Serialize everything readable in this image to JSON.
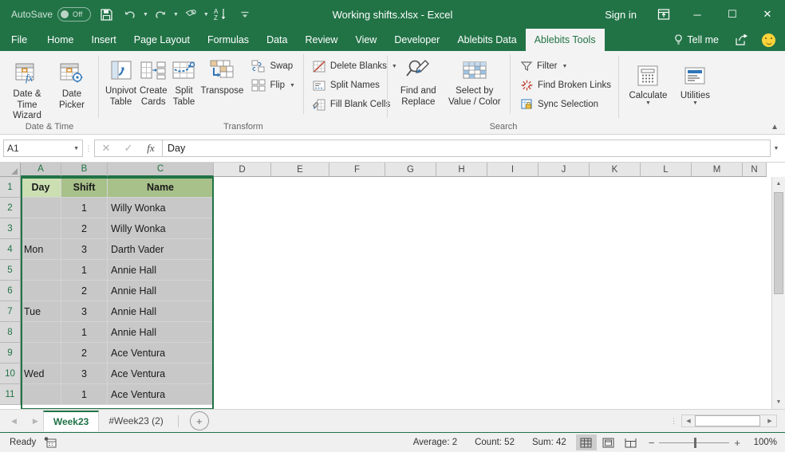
{
  "titlebar": {
    "autosave_label": "AutoSave",
    "autosave_state": "Off",
    "document_title": "Working shifts.xlsx  -  Excel",
    "signin_label": "Sign in",
    "minimize_label": "─",
    "maximize_label": "☐",
    "close_label": "✕",
    "qat": [
      {
        "name": "save-icon",
        "tip": "Save"
      },
      {
        "name": "undo-icon",
        "tip": "Undo"
      },
      {
        "name": "redo-icon",
        "tip": "Redo"
      },
      {
        "name": "touch-mouse-mode-icon",
        "tip": "Touch/Mouse Mode"
      },
      {
        "name": "sort-ascending-icon",
        "tip": "Sort A to Z"
      },
      {
        "name": "customize-quick-access-toolbar-icon",
        "tip": "Customize Quick Access Toolbar"
      }
    ]
  },
  "ribbon_tabs": [
    {
      "label": "File",
      "active": false
    },
    {
      "label": "Home",
      "active": false
    },
    {
      "label": "Insert",
      "active": false
    },
    {
      "label": "Page Layout",
      "active": false
    },
    {
      "label": "Formulas",
      "active": false
    },
    {
      "label": "Data",
      "active": false
    },
    {
      "label": "Review",
      "active": false
    },
    {
      "label": "View",
      "active": false
    },
    {
      "label": "Developer",
      "active": false
    },
    {
      "label": "Ablebits Data",
      "active": false
    },
    {
      "label": "Ablebits Tools",
      "active": true
    }
  ],
  "tellme_label": "Tell me",
  "ribbon": {
    "groups": [
      {
        "title": "Date & Time",
        "big_buttons": [
          {
            "label": "Date &\nTime Wizard",
            "line1": "Date &",
            "line2": "Time Wizard",
            "icon": "date-time-wizard-icon"
          },
          {
            "label": "Date\nPicker",
            "line1": "Date",
            "line2": "Picker",
            "icon": "date-picker-icon"
          }
        ]
      },
      {
        "title": "Transform",
        "big_buttons": [
          {
            "line1": "Unpivot",
            "line2": "Table",
            "icon": "unpivot-table-icon"
          },
          {
            "line1": "Create",
            "line2": "Cards",
            "icon": "create-cards-icon"
          },
          {
            "line1": "Split",
            "line2": "Table",
            "icon": "split-table-icon"
          },
          {
            "line1": "Transpose",
            "line2": "",
            "icon": "transpose-icon"
          }
        ],
        "small_buttons_1": [
          {
            "label": "Swap",
            "icon": "swap-icon",
            "dropdown": false
          },
          {
            "label": "Flip",
            "icon": "flip-icon",
            "dropdown": true
          }
        ],
        "small_buttons_2": [
          {
            "label": "Delete Blanks",
            "icon": "delete-blanks-icon",
            "dropdown": true
          },
          {
            "label": "Split Names",
            "icon": "split-names-icon",
            "dropdown": false
          },
          {
            "label": "Fill Blank Cells",
            "icon": "fill-blank-cells-icon",
            "dropdown": false
          }
        ]
      },
      {
        "title": "Search",
        "big_buttons": [
          {
            "line1": "Find and",
            "line2": "Replace",
            "icon": "find-and-replace-icon",
            "dropdown": true
          },
          {
            "line1": "Select by",
            "line2": "Value / Color",
            "icon": "select-by-value-color-icon",
            "dropdown": true
          }
        ],
        "small_buttons_1": [
          {
            "label": "Filter",
            "icon": "filter-icon",
            "dropdown": true
          },
          {
            "label": "Find Broken Links",
            "icon": "find-broken-links-icon",
            "dropdown": false
          },
          {
            "label": "Sync Selection",
            "icon": "sync-selection-icon",
            "dropdown": false
          }
        ]
      },
      {
        "title": "",
        "big_buttons": [
          {
            "line1": "Calculate",
            "line2": "",
            "icon": "calculate-icon",
            "dropdown": true
          },
          {
            "line1": "Utilities",
            "line2": "",
            "icon": "utilities-icon",
            "dropdown": true
          }
        ]
      }
    ]
  },
  "formula_bar": {
    "name_box_value": "A1",
    "cancel_label": "✕",
    "enter_label": "✓",
    "fx_label": "fx",
    "formula_value": "Day"
  },
  "grid": {
    "column_headers": [
      "A",
      "B",
      "C",
      "D",
      "E",
      "F",
      "G",
      "H",
      "I",
      "J",
      "K",
      "L",
      "M",
      "N"
    ],
    "selected_columns": [
      "A",
      "B",
      "C"
    ],
    "row_headers": [
      "1",
      "2",
      "3",
      "4",
      "5",
      "6",
      "7",
      "8",
      "9",
      "10",
      "11"
    ],
    "selected_rows": [
      "1",
      "2",
      "3",
      "4",
      "5",
      "6",
      "7",
      "8",
      "9",
      "10",
      "11"
    ],
    "table_headers": [
      "Day",
      "Shift",
      "Name"
    ],
    "rows": [
      {
        "row": "2",
        "day": "",
        "shift": "1",
        "name": "Willy Wonka"
      },
      {
        "row": "3",
        "day": "",
        "shift": "2",
        "name": "Willy Wonka"
      },
      {
        "row": "4",
        "day": "Mon",
        "shift": "3",
        "name": "Darth Vader"
      },
      {
        "row": "5",
        "day": "",
        "shift": "1",
        "name": "Annie Hall"
      },
      {
        "row": "6",
        "day": "",
        "shift": "2",
        "name": "Annie Hall"
      },
      {
        "row": "7",
        "day": "Tue",
        "shift": "3",
        "name": "Annie Hall"
      },
      {
        "row": "8",
        "day": "",
        "shift": "1",
        "name": "Annie Hall"
      },
      {
        "row": "9",
        "day": "",
        "shift": "2",
        "name": "Ace Ventura"
      },
      {
        "row": "10",
        "day": "Wed",
        "shift": "3",
        "name": "Ace Ventura"
      },
      {
        "row": "11",
        "day": "",
        "shift": "1",
        "name": "Ace Ventura"
      }
    ],
    "header_fill": "#a8c08a",
    "active_cell_fill": "#ccdfb3",
    "selection_fill": "#c8c8c8",
    "selection_border": "#217346"
  },
  "sheet_tabs": {
    "prev_label": "◀",
    "next_label": "▶",
    "tabs": [
      {
        "label": "Week23",
        "active": true
      },
      {
        "label": "#Week23 (2)",
        "active": false
      }
    ],
    "add_label": "+"
  },
  "status_bar": {
    "mode": "Ready",
    "macro_icon": "record-macro-icon",
    "average": "Average: 2",
    "count": "Count: 52",
    "sum": "Sum: 42",
    "views": [
      {
        "name": "normal-view-button",
        "active": true
      },
      {
        "name": "page-layout-view-button",
        "active": false
      },
      {
        "name": "page-break-preview-button",
        "active": false
      }
    ],
    "zoom_out": "−",
    "zoom_in": "+",
    "zoom_level": "100%"
  }
}
